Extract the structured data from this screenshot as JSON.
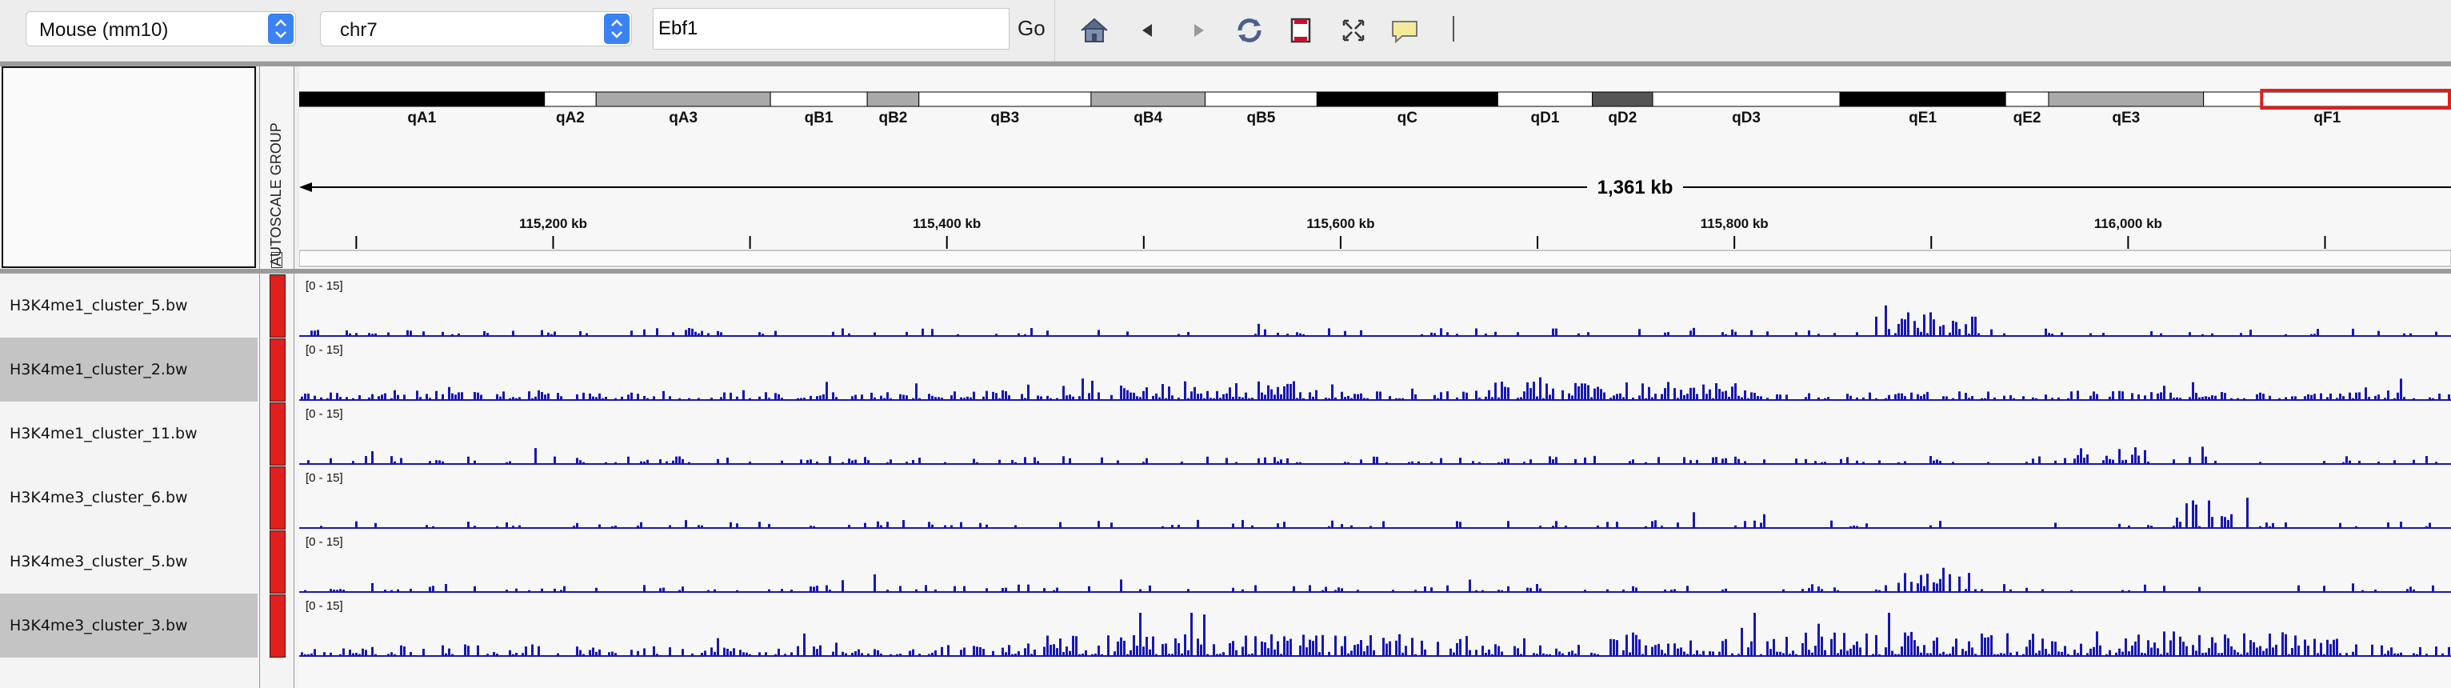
{
  "toolbar": {
    "genome_select": "Mouse (mm10)",
    "chromosome_select": "chr7",
    "locus_value": "Ebf1",
    "go_label": "Go",
    "icons": [
      "home-icon",
      "back-icon",
      "forward-icon",
      "refresh-icon",
      "roi-icon",
      "fit-icon",
      "popup-info-icon"
    ]
  },
  "attribute_header": {
    "label": "AUTOSCALE GROUP"
  },
  "ideogram": {
    "bands": [
      {
        "name": "qA1",
        "stain": "black",
        "start": 0,
        "end": 11.4
      },
      {
        "name": "qA2",
        "stain": "white",
        "start": 11.4,
        "end": 13.8
      },
      {
        "name": "qA3",
        "stain": "grey",
        "start": 13.8,
        "end": 21.9
      },
      {
        "name": "qB1",
        "stain": "white",
        "start": 21.9,
        "end": 26.4
      },
      {
        "name": "qB2",
        "stain": "grey",
        "start": 26.4,
        "end": 28.8
      },
      {
        "name": "qB3",
        "stain": "white",
        "start": 28.8,
        "end": 36.8
      },
      {
        "name": "qB4",
        "stain": "grey",
        "start": 36.8,
        "end": 42.1
      },
      {
        "name": "qB5",
        "stain": "white",
        "start": 42.1,
        "end": 47.3
      },
      {
        "name": "qC",
        "stain": "black",
        "start": 47.3,
        "end": 55.7
      },
      {
        "name": "qD1",
        "stain": "white",
        "start": 55.7,
        "end": 60.1
      },
      {
        "name": "qD2",
        "stain": "darkgrey",
        "start": 60.1,
        "end": 62.9
      },
      {
        "name": "qD3",
        "stain": "white",
        "start": 62.9,
        "end": 71.6
      },
      {
        "name": "qE1",
        "stain": "black",
        "start": 71.6,
        "end": 79.3
      },
      {
        "name": "qE2",
        "stain": "white",
        "start": 79.3,
        "end": 81.3
      },
      {
        "name": "qE3",
        "stain": "grey",
        "start": 81.3,
        "end": 88.5
      },
      {
        "name": "qF1",
        "stain": "white",
        "start": 88.5,
        "end": 100
      }
    ],
    "region_start": 91.2,
    "region_end": 100
  },
  "ruler": {
    "span_label": "1,361 kb",
    "tick_labels": [
      "115,200 kb",
      "115,400 kb",
      "115,600 kb",
      "115,800 kb",
      "116,000 kb"
    ],
    "tick_positions_bp": [
      115200000,
      115400000,
      115600000,
      115800000,
      116000000
    ],
    "minor_tick_positions_bp": [
      115100000,
      115300000,
      115500000,
      115700000,
      115900000,
      116100000
    ],
    "view_start_bp": 115071000,
    "view_end_bp": 116164000
  },
  "tracks": [
    {
      "name": "H3K4me1_cluster_5.bw",
      "range": "[0 - 15]",
      "selected": false,
      "seed": 11,
      "density": 0.22,
      "baseline": 2.2,
      "hotspots": [
        [
          0.73,
          0.78,
          10
        ]
      ]
    },
    {
      "name": "H3K4me1_cluster_2.bw",
      "range": "[0 - 15]",
      "selected": true,
      "seed": 23,
      "density": 0.55,
      "baseline": 2.8,
      "hotspots": [
        [
          0.38,
          0.48,
          6
        ],
        [
          0.55,
          0.68,
          6
        ]
      ]
    },
    {
      "name": "H3K4me1_cluster_11.bw",
      "range": "[0 - 15]",
      "selected": false,
      "seed": 37,
      "density": 0.25,
      "baseline": 2.2,
      "hotspots": [
        [
          0.82,
          0.86,
          6
        ]
      ]
    },
    {
      "name": "H3K4me3_cluster_6.bw",
      "range": "[0 - 15]",
      "selected": false,
      "seed": 41,
      "density": 0.16,
      "baseline": 2.2,
      "hotspots": [
        [
          0.86,
          0.92,
          11
        ]
      ]
    },
    {
      "name": "H3K4me3_cluster_5.bw",
      "range": "[0 - 15]",
      "selected": false,
      "seed": 53,
      "density": 0.18,
      "baseline": 2.2,
      "hotspots": [
        [
          0.74,
          0.78,
          8
        ]
      ]
    },
    {
      "name": "H3K4me3_cluster_3.bw",
      "range": "[0 - 15]",
      "selected": true,
      "seed": 67,
      "density": 0.5,
      "baseline": 3.5,
      "hotspots": [
        [
          0.33,
          0.55,
          7
        ],
        [
          0.6,
          0.95,
          8
        ]
      ]
    }
  ],
  "colors": {
    "signal": "#1818b0",
    "attribute": "#e0201c",
    "region_box": "#e0201c"
  }
}
